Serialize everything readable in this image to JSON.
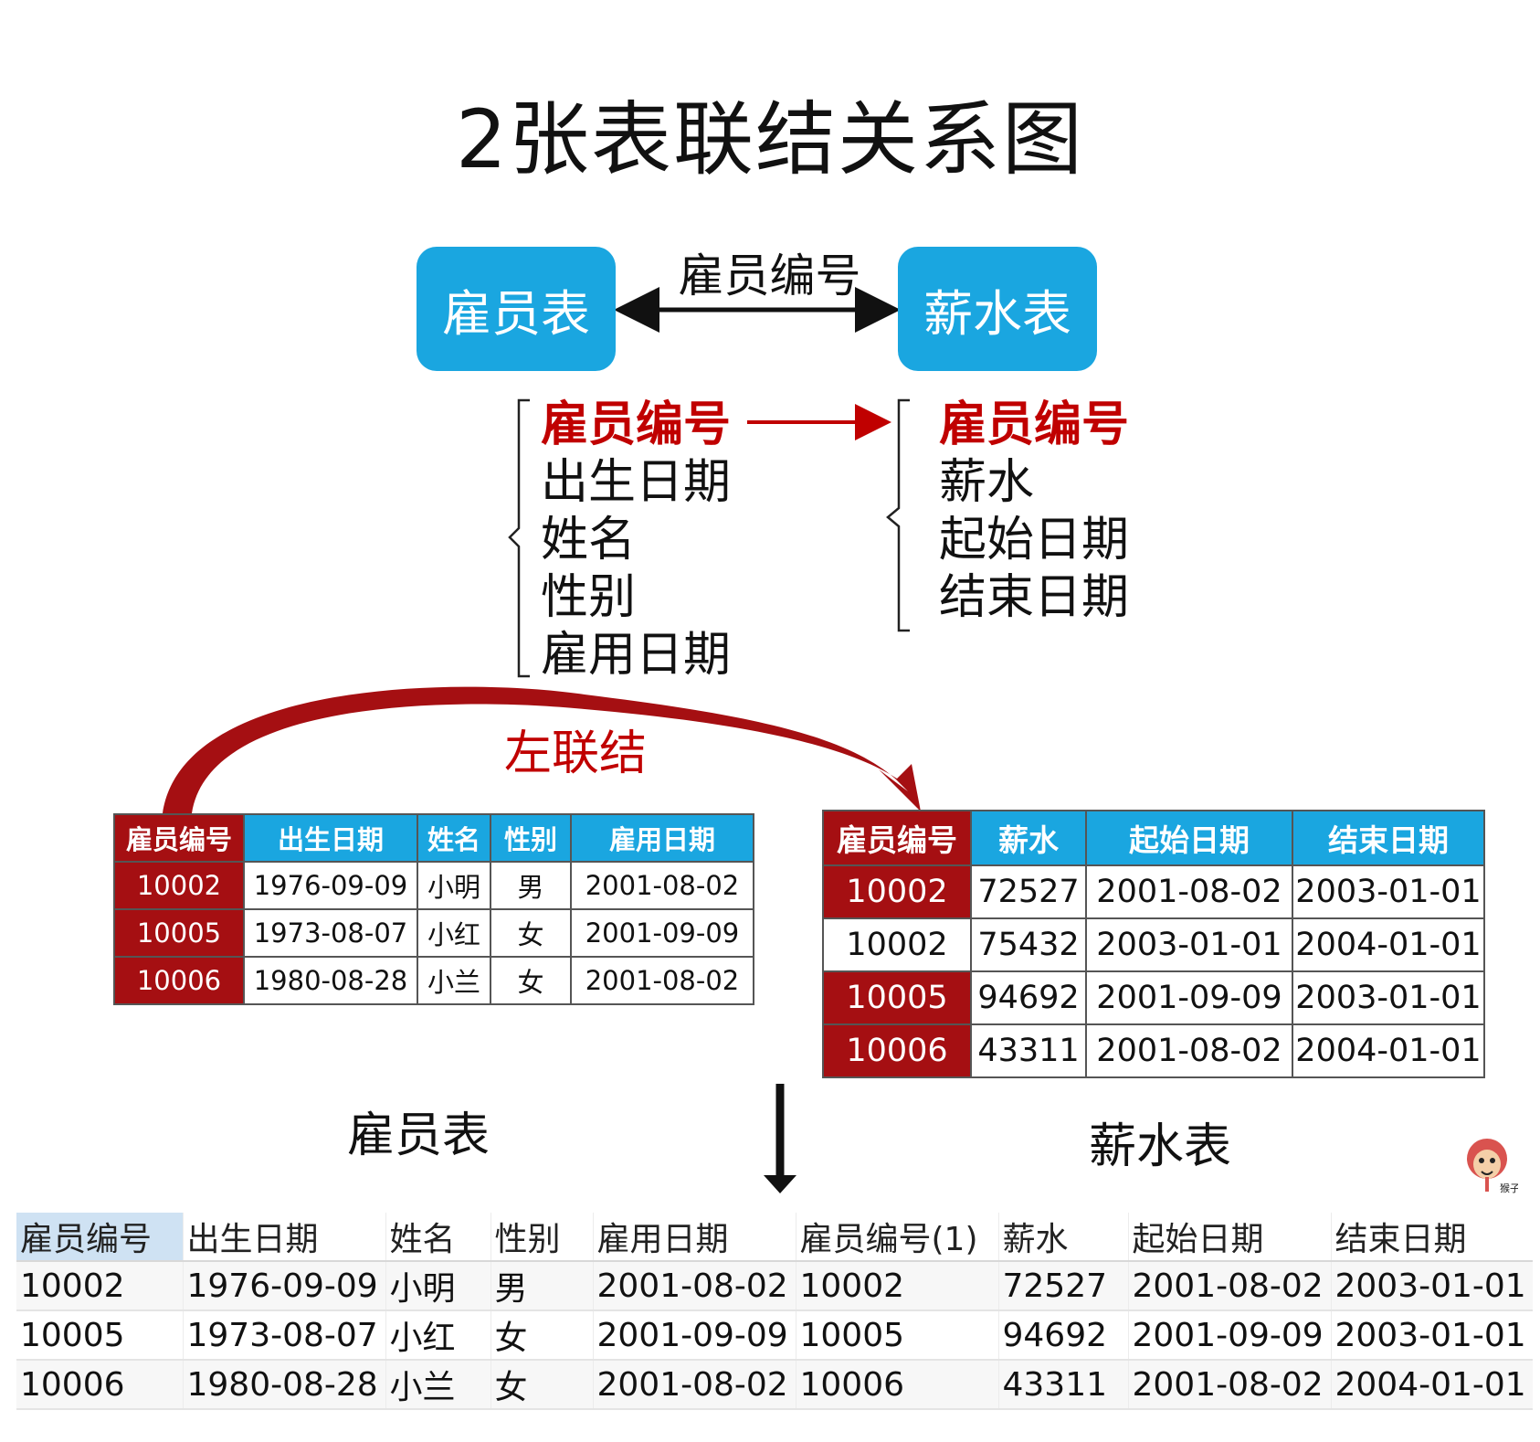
{
  "title": "2张表联结关系图",
  "boxes": {
    "employee": "雇员表",
    "salary": "薪水表"
  },
  "link_label": "雇员编号",
  "employee_fields": [
    "雇员编号",
    "出生日期",
    "姓名",
    "性别",
    "雇用日期"
  ],
  "salary_fields": [
    "雇员编号",
    "薪水",
    "起始日期",
    "结束日期"
  ],
  "join_label": "左联结",
  "employee_table": {
    "headers": [
      "雇员编号",
      "出生日期",
      "姓名",
      "性别",
      "雇用日期"
    ],
    "rows": [
      [
        "10002",
        "1976-09-09",
        "小明",
        "男",
        "2001-08-02"
      ],
      [
        "10005",
        "1973-08-07",
        "小红",
        "女",
        "2001-09-09"
      ],
      [
        "10006",
        "1980-08-28",
        "小兰",
        "女",
        "2001-08-02"
      ]
    ],
    "caption": "雇员表"
  },
  "salary_table": {
    "headers": [
      "雇员编号",
      "薪水",
      "起始日期",
      "结束日期"
    ],
    "rows": [
      [
        "10002",
        "72527",
        "2001-08-02",
        "2003-01-01"
      ],
      [
        "10002",
        "75432",
        "2003-01-01",
        "2004-01-01"
      ],
      [
        "10005",
        "94692",
        "2001-09-09",
        "2003-01-01"
      ],
      [
        "10006",
        "43311",
        "2001-08-02",
        "2004-01-01"
      ]
    ],
    "highlighted_rows": [
      0,
      2,
      3
    ],
    "caption": "薪水表"
  },
  "result_table": {
    "headers": [
      "雇员编号",
      "出生日期",
      "姓名",
      "性别",
      "雇用日期",
      "雇员编号(1)",
      "薪水",
      "起始日期",
      "结束日期"
    ],
    "rows": [
      [
        "10002",
        "1976-09-09",
        "小明",
        "男",
        "2001-08-02",
        "10002",
        "72527",
        "2001-08-02",
        "2003-01-01"
      ],
      [
        "10005",
        "1973-08-07",
        "小红",
        "女",
        "2001-09-09",
        "10005",
        "94692",
        "2001-09-09",
        "2003-01-01"
      ],
      [
        "10006",
        "1980-08-28",
        "小兰",
        "女",
        "2001-08-02",
        "10006",
        "43311",
        "2001-08-02",
        "2004-01-01"
      ]
    ]
  },
  "logo_text": "猴子",
  "colors": {
    "box_blue": "#1aa6e0",
    "key_red": "#c00000",
    "cell_red": "#a50f12",
    "arrow_red": "#a50f12"
  }
}
